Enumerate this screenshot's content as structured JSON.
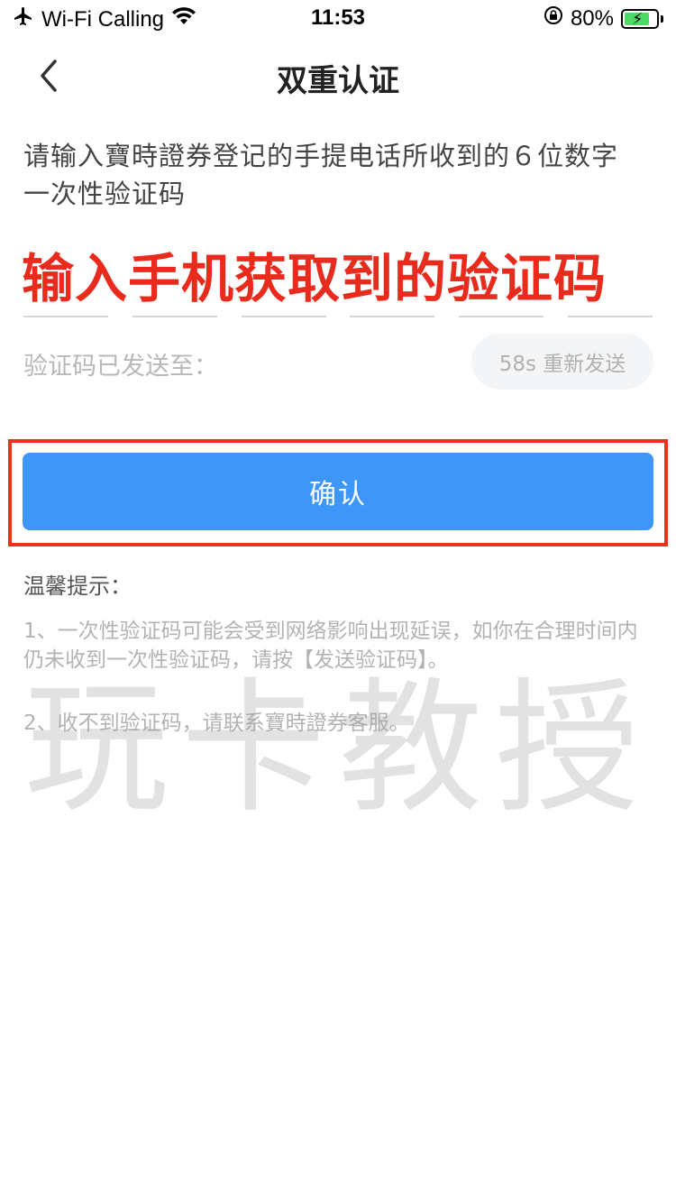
{
  "status_bar": {
    "carrier": "Wi-Fi Calling",
    "time": "11:53",
    "battery": "80%",
    "battery_level": 0.8,
    "icons": [
      "airplane-icon",
      "wifi-icon",
      "orientation-lock-icon",
      "battery-charging-icon"
    ]
  },
  "nav": {
    "title": "双重认证",
    "back_icon": "chevron-left-icon"
  },
  "prompt": {
    "line1": "请输入寶時證券登记的手提电话所收到的６位数字",
    "line2": "一次性验证码"
  },
  "annotation": "输入手机获取到的验证码",
  "otp": {
    "digits": 6
  },
  "sent": {
    "label": "验证码已发送至：",
    "resend_label": "58s 重新发送"
  },
  "confirm_label": "确认",
  "tips": {
    "title": "温馨提示：",
    "item1": "1、一次性验证码可能会受到网络影响出现延误，如你在合理时间内仍未收到一次性验证码，请按【发送验证码】。",
    "item2": "2、收不到验证码，请联系寶時證券客服。"
  },
  "watermark": "玩卡教授",
  "colors": {
    "primary": "#3e96f8",
    "annotation": "#e82b1d",
    "battery": "#4cd964"
  }
}
